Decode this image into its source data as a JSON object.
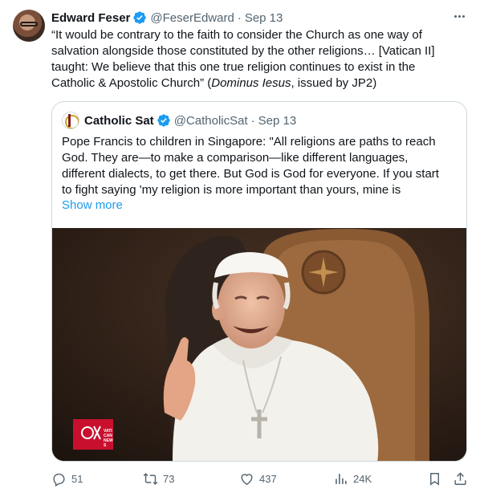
{
  "tweet": {
    "author_name": "Edward Feser",
    "author_handle": "@FeserEdward",
    "separator": "·",
    "date": "Sep 13",
    "text_line1": "“It would be contrary to the faith to consider the Church as one way of",
    "text_line2": "salvation alongside those constituted by the other religions… [Vatican II]",
    "text_line3": "taught: We believe that this one true religion continues to exist in the",
    "text_line4a": "Catholic & Apostolic Church” (",
    "text_line4_italic": "Dominus Iesus",
    "text_line4b": ", issued by JP2)"
  },
  "quote": {
    "author_name": "Catholic Sat",
    "author_handle": "@CatholicSat",
    "separator": "·",
    "date": "Sep 13",
    "line1": "Pope Francis to children in Singapore: \"All religions are paths to reach",
    "line2": "God. They are—to make a comparison—like different languages,",
    "line3": "different dialects, to get there. But God is God for everyone. If you start",
    "line4": "to fight saying 'my religion is more important than yours, mine is",
    "show_more": "Show more",
    "media_watermark": "VATICAN NEWS"
  },
  "actions": {
    "replies": "51",
    "reposts": "73",
    "likes": "437",
    "views": "24K"
  },
  "icons": {
    "verified": "verified-badge-icon",
    "more": "more-icon",
    "reply": "reply-icon",
    "repost": "repost-icon",
    "like": "like-icon",
    "views": "views-icon",
    "bookmark": "bookmark-icon",
    "share": "share-icon"
  },
  "colors": {
    "accent": "#1d9bf0",
    "text": "#0f1419",
    "muted": "#536471",
    "border": "#cfd9de"
  }
}
